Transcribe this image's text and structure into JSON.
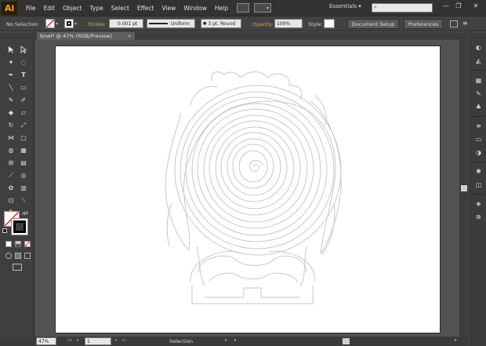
{
  "app": {
    "logo": "Ai"
  },
  "menu": [
    "File",
    "Edit",
    "Object",
    "Type",
    "Select",
    "Effect",
    "View",
    "Window",
    "Help"
  ],
  "workspace": {
    "label": "Essentials",
    "arrow": "▾"
  },
  "window_controls": {
    "minimize": "—",
    "restore": "❐",
    "close": "✕"
  },
  "control_bar": {
    "selection": "No Selection",
    "stroke_label": "Stroke:",
    "stroke_weight": "0.001 pt",
    "profile": "Uniform",
    "brush": "3 pt. Round",
    "opacity_label": "Opacity:",
    "opacity_value": "100%",
    "style_label": "Style:",
    "document_setup": "Document Setup",
    "preferences": "Preferences"
  },
  "document_tab": {
    "title": "bowl* @ 47% (RGB/Preview)",
    "close": "×"
  },
  "status_bar": {
    "zoom": "47%",
    "artboard": "1",
    "tool": "Selection"
  },
  "colors": {
    "accent": "#f7a51c",
    "panel": "#3f3f3f",
    "canvas": "#535353",
    "artboard": "#ffffff",
    "line_art": "#c8c8c8"
  },
  "icons": {
    "selection": "arrow-icon",
    "direct_selection": "hollow-arrow-icon",
    "pen": "pen-icon",
    "type": "type-icon",
    "zoom": "zoom-icon",
    "hand": "hand-icon",
    "search": "search-icon"
  }
}
